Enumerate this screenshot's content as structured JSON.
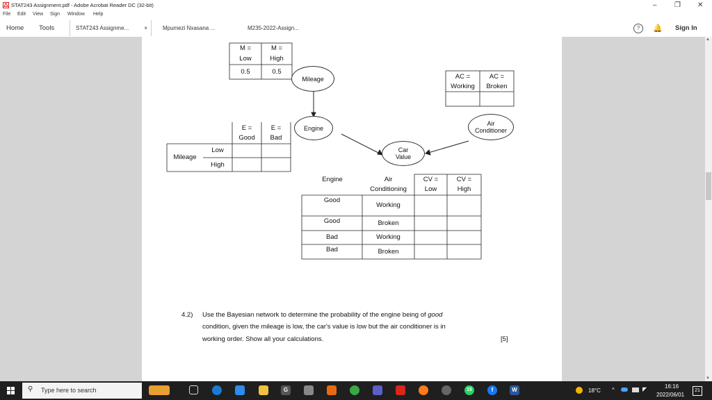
{
  "window": {
    "title": "STAT243 Assignment.pdf - Adobe Acrobat Reader DC (32-bit)",
    "controls": {
      "minimize": "–",
      "maximize": "❐",
      "close": "✕"
    }
  },
  "menu": [
    "File",
    "Edit",
    "View",
    "Sign",
    "Window",
    "Help"
  ],
  "nav": {
    "home": "Home",
    "tools": "Tools"
  },
  "tabs": [
    {
      "label": "STAT243 Assignme...",
      "close": "×"
    },
    {
      "label": "Mpumezi Nxasana ..."
    },
    {
      "label": "M235-2022-Assign..."
    }
  ],
  "toolbar_right": {
    "help": "?",
    "sign_in": "Sign In"
  },
  "cpt_mileage": {
    "h1": [
      "M =",
      "Low"
    ],
    "h2": [
      "M =",
      "High"
    ],
    "v1": "0.5",
    "v2": "0.5"
  },
  "cpt_ac": {
    "h1": [
      "AC =",
      "Working"
    ],
    "h2": [
      "AC =",
      "Broken"
    ]
  },
  "cpt_engine": {
    "h1": [
      "E =",
      "Good"
    ],
    "h2": [
      "E =",
      "Bad"
    ],
    "row_label": "Mileage",
    "r1": "Low",
    "r2": "High"
  },
  "nodes": {
    "mileage": "Mileage",
    "engine": "Engine",
    "air_conditioner": [
      "Air",
      "Conditioner"
    ],
    "car_value": [
      "Car",
      "Value"
    ]
  },
  "cpt_cv": {
    "headers": {
      "engine": "Engine",
      "ac": [
        "Air",
        "Conditioning"
      ],
      "low": [
        "CV =",
        "Low"
      ],
      "high": [
        "CV =",
        "High"
      ]
    },
    "rows": [
      {
        "engine": "Good",
        "ac": "Working"
      },
      {
        "engine": "Good",
        "ac": "Broken"
      },
      {
        "engine": "Bad",
        "ac": "Working"
      },
      {
        "engine": "Bad",
        "ac": "Broken"
      }
    ]
  },
  "question": {
    "number": "4.2)",
    "line1_pre": "Use the Bayesian network to determine the probability of the engine being of ",
    "line1_em": "good",
    "line2": "condition, given the mileage is low, the car's value is low but the air conditioner is in",
    "line3": "working order. Show all your calculations.",
    "marks": "[5]"
  },
  "taskbar": {
    "search_placeholder": "Type here to search",
    "weather": "18°C",
    "time": "16:16",
    "date": "2022/06/01",
    "notification_count": "21",
    "badge_count": "15"
  }
}
